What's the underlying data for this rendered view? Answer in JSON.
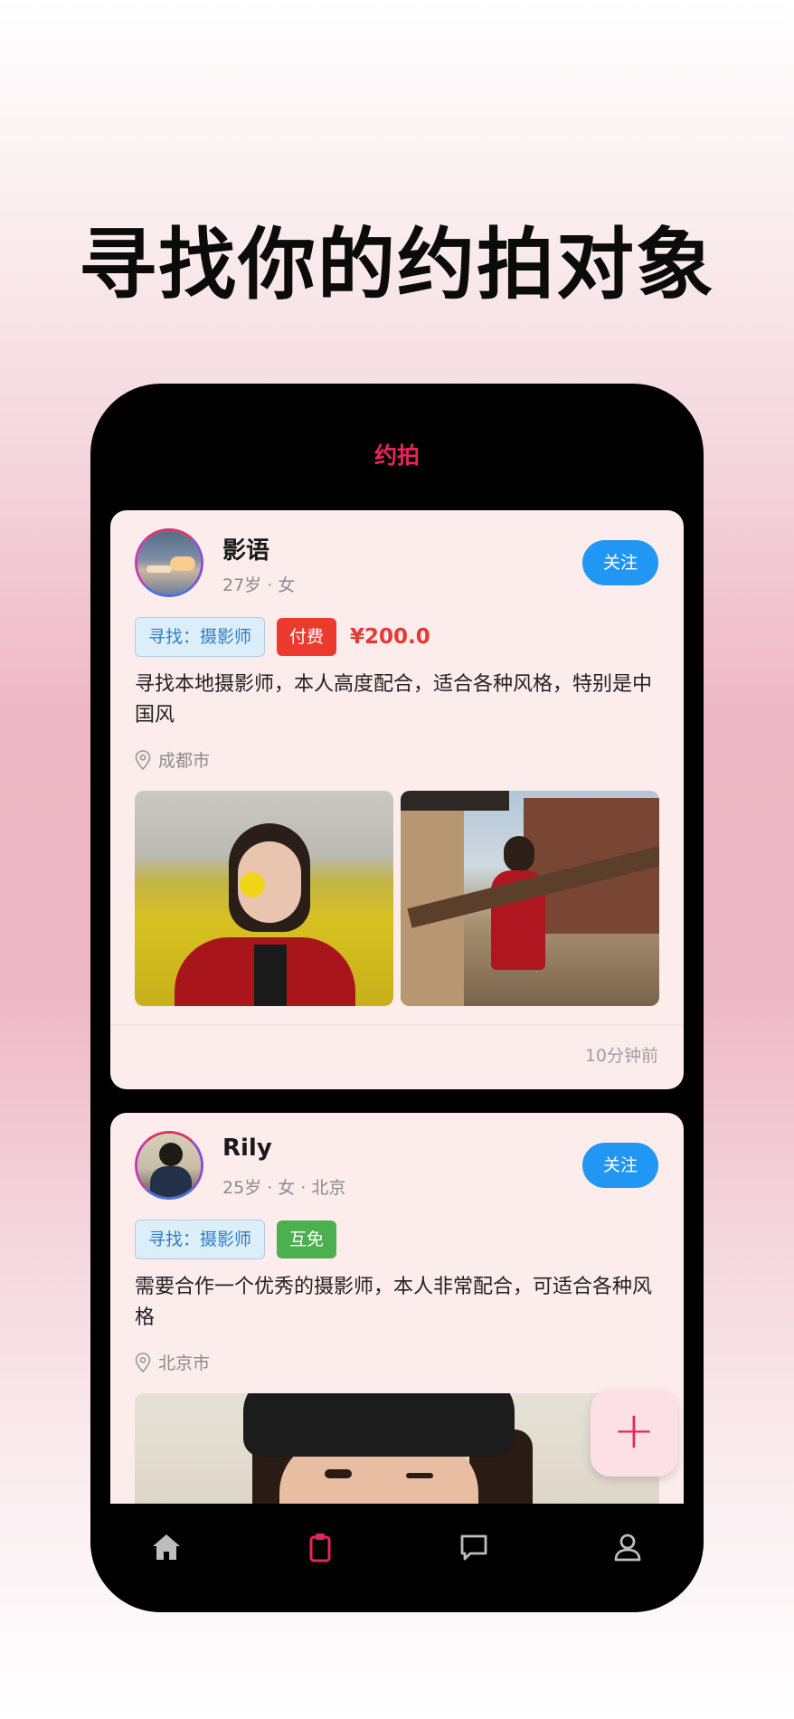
{
  "headline": "寻找你的约拍对象",
  "app": {
    "title": "约拍"
  },
  "posts": [
    {
      "name": "影语",
      "meta": "27岁 · 女",
      "follow_label": "关注",
      "seek_tag": "寻找：摄影师",
      "fee_tag": "付费",
      "price": "¥200.0",
      "description": "寻找本地摄影师，本人高度配合，适合各种风格，特别是中国风",
      "location": "成都市",
      "time": "10分钟前"
    },
    {
      "name": "Rily",
      "meta": "25岁 · 女 · 北京",
      "follow_label": "关注",
      "seek_tag": "寻找：摄影师",
      "fee_tag": "互免",
      "description": "需要合作一个优秀的摄影师，本人非常配合，可适合各种风格",
      "location": "北京市"
    }
  ],
  "fab": {
    "symbol": "+"
  },
  "tabbar": {
    "items": [
      {
        "icon": "home-icon",
        "active": false
      },
      {
        "icon": "clipboard-icon",
        "active": true
      },
      {
        "icon": "chat-icon",
        "active": false
      },
      {
        "icon": "profile-icon",
        "active": false
      }
    ]
  },
  "colors": {
    "accent": "#e8245c",
    "follow": "#2196f3",
    "paid": "#ec3a2e",
    "mutual": "#4caf50",
    "price": "#e53935"
  }
}
